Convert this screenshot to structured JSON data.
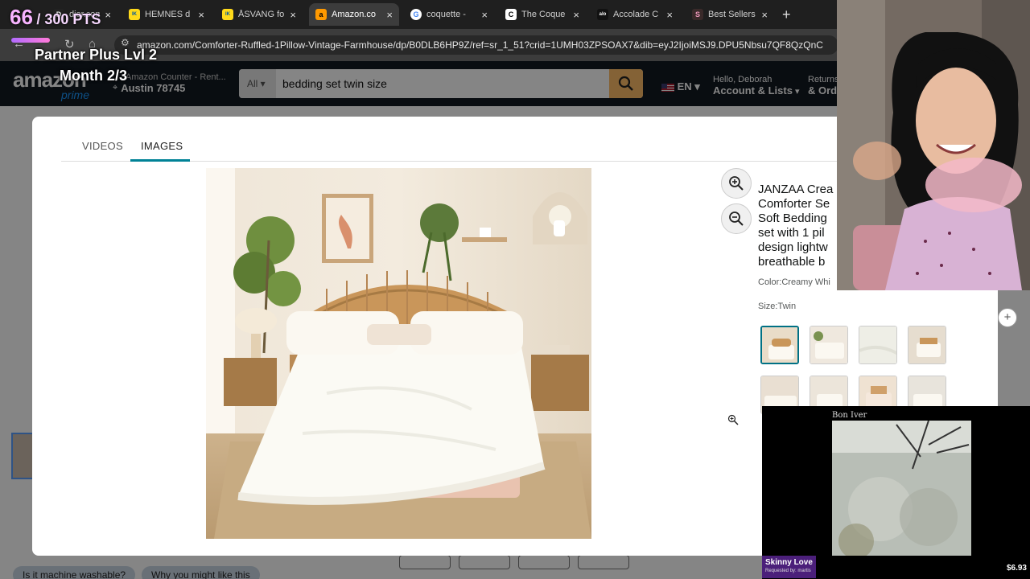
{
  "browser": {
    "tabs": [
      {
        "title": "dior.com/e",
        "favicon": "D",
        "active": false
      },
      {
        "title": "HEMNES d",
        "favicon": "IK",
        "active": false
      },
      {
        "title": "ÅSVANG fo",
        "favicon": "IK",
        "active": false
      },
      {
        "title": "Amazon.co",
        "favicon": "a",
        "active": true
      },
      {
        "title": "coquette -",
        "favicon": "G",
        "active": false
      },
      {
        "title": "The Coque",
        "favicon": "C",
        "active": false
      },
      {
        "title": "Accolade C",
        "favicon": "alo",
        "active": false
      },
      {
        "title": "Best Sellers",
        "favicon": "S",
        "active": false
      }
    ],
    "url": "amazon.com/Comforter-Ruffled-1Pillow-Vintage-Farmhouse/dp/B0DLB6HP9Z/ref=sr_1_51?crid=1UMH03ZPSOAX7&dib=eyJ2IjoiMSJ9.DPU5Nbsu7QF8QzQnC"
  },
  "amazon_header": {
    "logo": "amazon",
    "prime": "prime",
    "deliver_line1": "Amazon Counter - Rent...",
    "deliver_line2": "Austin 78745",
    "search_category": "All",
    "search_query": "bedding set twin size",
    "language": "EN",
    "greeting": "Hello, Deborah",
    "account": "Account & Lists",
    "returns_line1": "Returns",
    "returns_line2": "& Ord"
  },
  "page": {
    "chips": [
      "Is it machine washable?",
      "Why you might like this"
    ]
  },
  "modal": {
    "tabs": [
      "VIDEOS",
      "IMAGES"
    ],
    "active_tab": "IMAGES",
    "product_title": "JANZAA Crea Comforter Se Soft Bedding set with 1 pil design lightw breathable b",
    "color": "Color:Creamy Whi",
    "size": "Size:Twin"
  },
  "stream": {
    "points_value": "66",
    "points_total": "/ 300 PTS",
    "partner_line1": "Partner Plus Lvl 2",
    "partner_line2": "Month 2/3",
    "now_playing_artist": "Bon Iver",
    "song": "Skinny Love",
    "requested_by": "Requested by: martis",
    "price": "$6.93"
  },
  "colors": {
    "amazon_dark": "#131921",
    "search_button": "#febd69",
    "tab_underline": "#008296",
    "thumb_selected": "#007185"
  }
}
